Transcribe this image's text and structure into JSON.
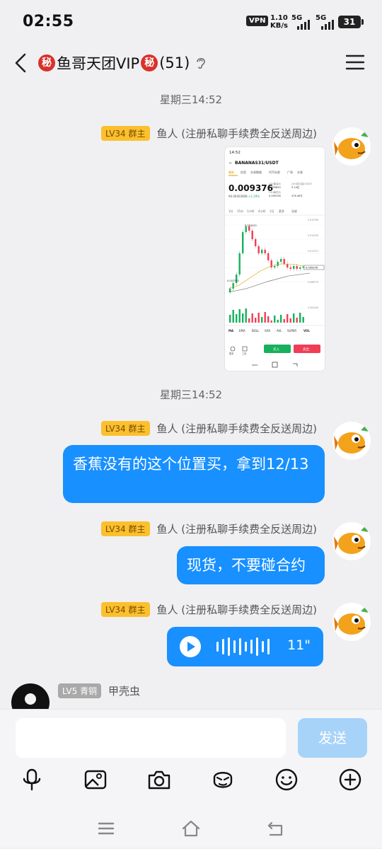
{
  "status_bar": {
    "time": "02:55",
    "vpn": "VPN",
    "speed_value": "1.10",
    "speed_unit": "KB/s",
    "net1": "5G",
    "net2": "5G",
    "battery": "31"
  },
  "header": {
    "badge_left": "秘",
    "title": "鱼哥天团VIP",
    "badge_right": "秘",
    "count": "(51)"
  },
  "messages": {
    "stamp_1": "星期三14:52",
    "stamp_2": "星期三14:52",
    "owner_level": "LV34 群主",
    "owner_name": "鱼人 (注册私聊手续费全反送周边)",
    "text_1": "香蕉没有的这个位置买，拿到12/13",
    "text_2": "现货，不要碰合约",
    "voice_duration": "11\"",
    "other_level": "LV5 青铜",
    "other_name": "甲壳虫"
  },
  "screenshot": {
    "time": "14:52",
    "pair": "BANANAS31/USDT",
    "tabs": [
      "最新",
      "信息",
      "交易数据",
      "代币社群",
      "广场",
      "交易"
    ],
    "price": "0.009376",
    "sub_price": "¥0.06403808",
    "change": "+1.29%",
    "high_label": "24h最高价",
    "high_val": "0.009650",
    "low_label": "24h最低价",
    "low_val": "0.009156",
    "vol_label": "24h成交量(USDT)",
    "vol_val": "5.14亿",
    "vol2_val": "476.46万",
    "ranges": [
      "1分",
      "15分",
      "1小时",
      "4小时",
      "1日",
      "更多",
      "深度"
    ],
    "peak_label": "0.016255",
    "low_mark": "0.007353",
    "axis": [
      "0.015799",
      "0.014230",
      "0.011317",
      "0.009376",
      "0.006773",
      "0.004240"
    ],
    "last_label": "0.009376",
    "indicators": [
      "MA",
      "EMA",
      "BOLL",
      "SAR",
      "AVL",
      "SUPER",
      "VOL"
    ],
    "buy": "买入",
    "sell": "卖出",
    "foot_a": "更多",
    "foot_b": "工具"
  },
  "composer": {
    "send": "发送"
  },
  "colors": {
    "bubble": "#1890ff",
    "send_disabled": "#a7d3f9",
    "owner_badge": "#fbc02d",
    "secret_badge": "#d9312b",
    "buy": "#16b15c",
    "sell": "#ef3e55"
  }
}
